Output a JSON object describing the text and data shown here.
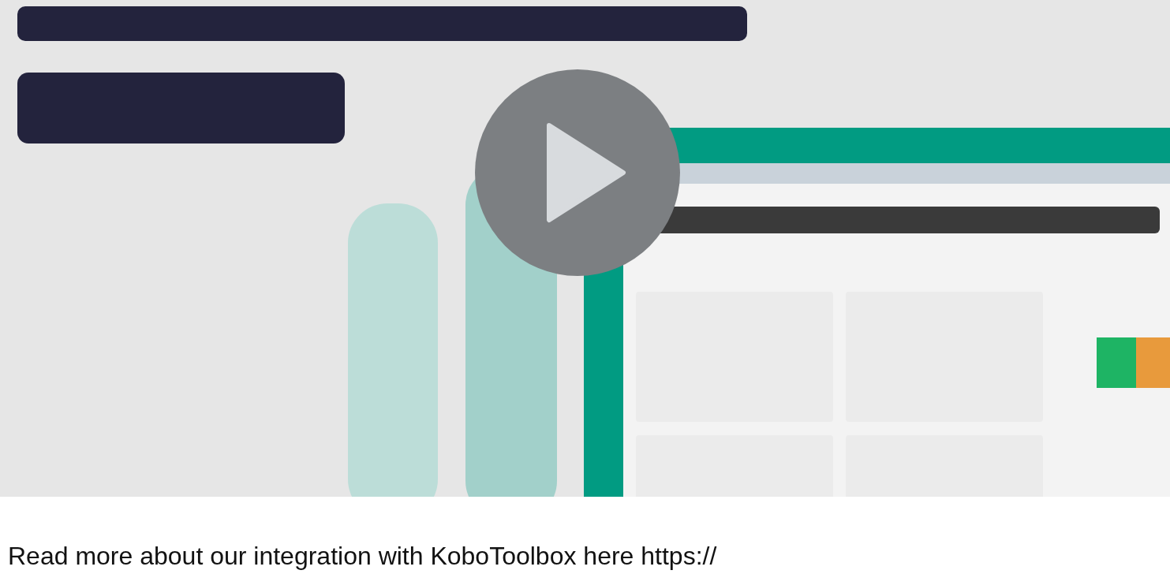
{
  "caption": {
    "text": "Read more about our integration with KoboToolbox here",
    "link": "https://"
  }
}
